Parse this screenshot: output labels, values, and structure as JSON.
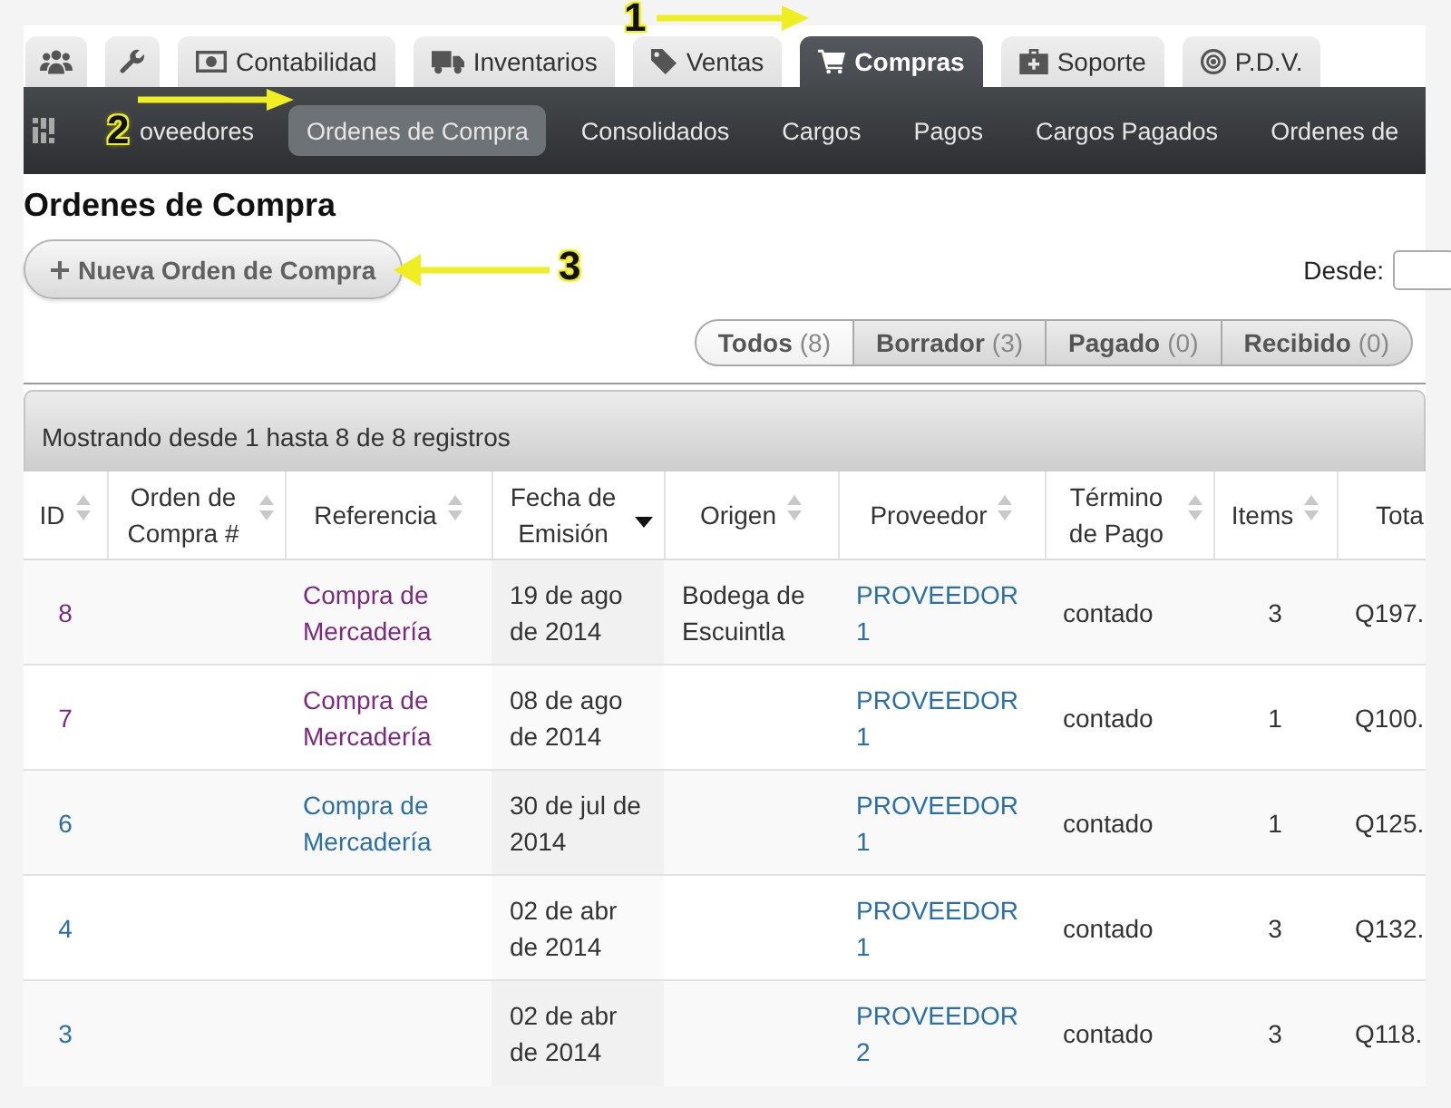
{
  "tabs": [
    {
      "selected": false
    },
    {
      "selected": false
    },
    {
      "label": "Contabilidad",
      "selected": false
    },
    {
      "label": "Inventarios",
      "selected": false
    },
    {
      "label": "Ventas",
      "selected": false
    },
    {
      "label": "Compras",
      "selected": true
    },
    {
      "label": "Soporte",
      "selected": false
    },
    {
      "label": "P.D.V.",
      "selected": false
    }
  ],
  "subnav": {
    "items": [
      {
        "label": "oveedores",
        "selected": false
      },
      {
        "label": "Ordenes de Compra",
        "selected": true
      },
      {
        "label": "Consolidados",
        "selected": false
      },
      {
        "label": "Cargos",
        "selected": false
      },
      {
        "label": "Pagos",
        "selected": false
      },
      {
        "label": "Cargos Pagados",
        "selected": false
      },
      {
        "label": "Ordenes de",
        "selected": false
      }
    ]
  },
  "page_title": "Ordenes de Compra",
  "new_button": {
    "label": "Nueva Orden de Compra"
  },
  "date_from": {
    "label": "Desde:"
  },
  "filters": [
    {
      "label": "Todos",
      "count": "(8)",
      "selected": true
    },
    {
      "label": "Borrador",
      "count": "(3)",
      "selected": false
    },
    {
      "label": "Pagado",
      "count": "(0)",
      "selected": false
    },
    {
      "label": "Recibido",
      "count": "(0)",
      "selected": false
    }
  ],
  "table": {
    "info": "Mostrando desde 1 hasta 8 de 8 registros",
    "columns": [
      {
        "label": "ID",
        "sorted": false
      },
      {
        "label": "Orden de Compra #",
        "sorted": false
      },
      {
        "label": "Referencia",
        "sorted": false
      },
      {
        "label": "Fecha de Emisión",
        "sorted": true
      },
      {
        "label": "Origen",
        "sorted": false
      },
      {
        "label": "Proveedor",
        "sorted": false
      },
      {
        "label": "Término de Pago",
        "sorted": false
      },
      {
        "label": "Items",
        "sorted": false
      },
      {
        "label": "Tota"
      }
    ],
    "rows": [
      {
        "id": "8",
        "visited": true,
        "reference": "Compra de Mercadería",
        "date": "19 de ago de 2014",
        "origin": "Bodega de Escuintla",
        "supplier": "PROVEEDOR 1",
        "payment_term": "contado",
        "items": "3",
        "total": "Q197."
      },
      {
        "id": "7",
        "visited": true,
        "reference": "Compra de Mercadería",
        "date": "08 de ago de 2014",
        "supplier": "PROVEEDOR 1",
        "payment_term": "contado",
        "items": "1",
        "total": "Q100."
      },
      {
        "id": "6",
        "visited": false,
        "reference": "Compra de Mercadería",
        "date": "30 de jul de 2014",
        "supplier": "PROVEEDOR 1",
        "payment_term": "contado",
        "items": "1",
        "total": "Q125."
      },
      {
        "id": "4",
        "visited": false,
        "date": "02 de abr de 2014",
        "supplier": "PROVEEDOR 1",
        "payment_term": "contado",
        "items": "3",
        "total": "Q132."
      },
      {
        "id": "3",
        "visited": false,
        "date": "02 de abr de 2014",
        "supplier": "PROVEEDOR 2",
        "payment_term": "contado",
        "items": "3",
        "total": "Q118."
      }
    ]
  },
  "annotations": [
    {
      "number": "1",
      "points_left": false
    },
    {
      "number": "2",
      "points_left": false
    },
    {
      "number": "3",
      "points_left": true
    }
  ]
}
